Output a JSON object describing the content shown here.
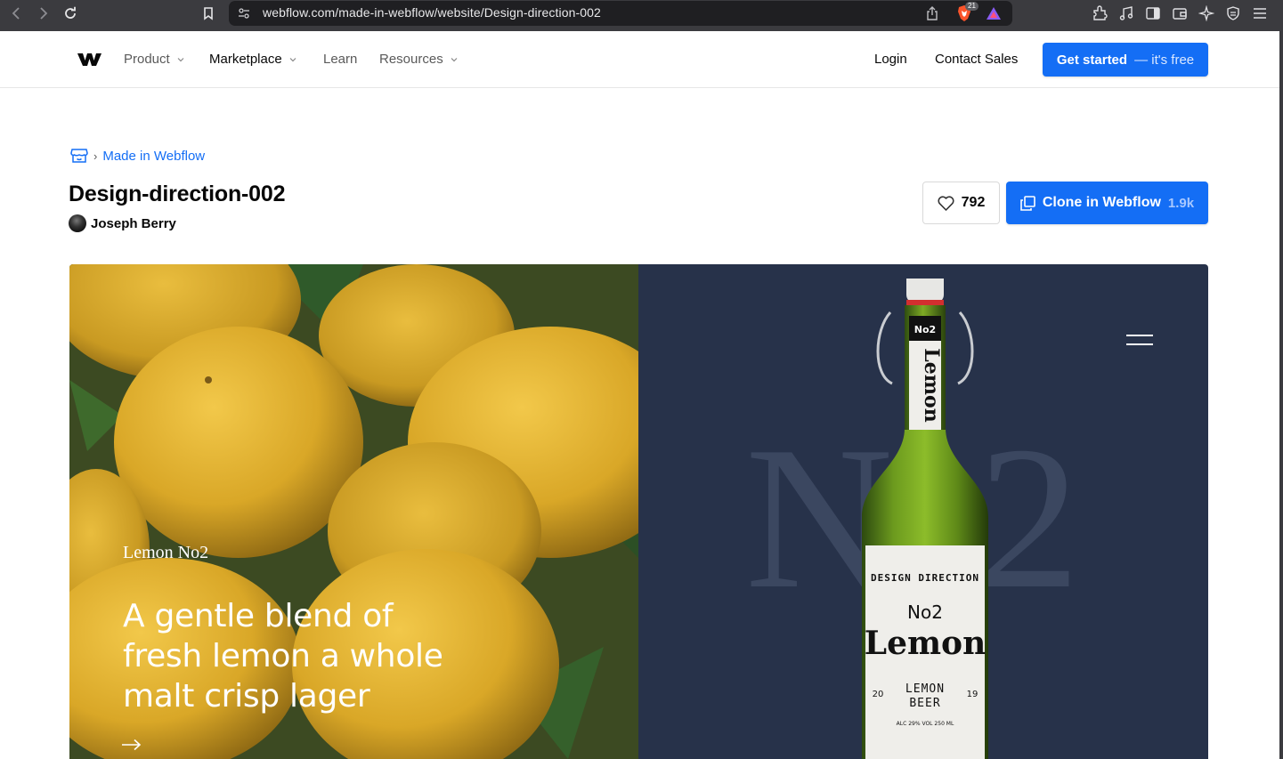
{
  "browser": {
    "url": "webflow.com/made-in-webflow/website/Design-direction-002",
    "shields_count": "21"
  },
  "nav": {
    "items": [
      {
        "label": "Product",
        "has_dropdown": true
      },
      {
        "label": "Marketplace",
        "has_dropdown": true
      },
      {
        "label": "Learn",
        "has_dropdown": false
      },
      {
        "label": "Resources",
        "has_dropdown": true
      }
    ],
    "login": "Login",
    "contact": "Contact Sales",
    "cta_main": "Get started",
    "cta_sub": "— it's free"
  },
  "breadcrumb": {
    "separator": "›",
    "link": "Made in Webflow"
  },
  "site": {
    "title": "Design-direction-002",
    "author": "Joseph Berry",
    "likes": "792",
    "clone_label": "Clone in Webflow",
    "clone_count": "1.9k"
  },
  "preview": {
    "brand": "Lemon No2",
    "headline": "A gentle blend of fresh lemon a whole malt crisp lager",
    "arrow": "→",
    "big_number": "No2",
    "label": {
      "cap": "No2",
      "neck": "Lemon",
      "arc": "DESIGN DIRECTION",
      "number": "No2",
      "name": "Lemon",
      "year_left": "20",
      "year_right": "19",
      "line1": "LEMON",
      "line2": "BEER",
      "small": "ALC 29% VOL 250 ML"
    }
  },
  "colors": {
    "accent": "#146ef5",
    "chrome": "#3b3b3f",
    "preview_navy": "#27324a"
  }
}
